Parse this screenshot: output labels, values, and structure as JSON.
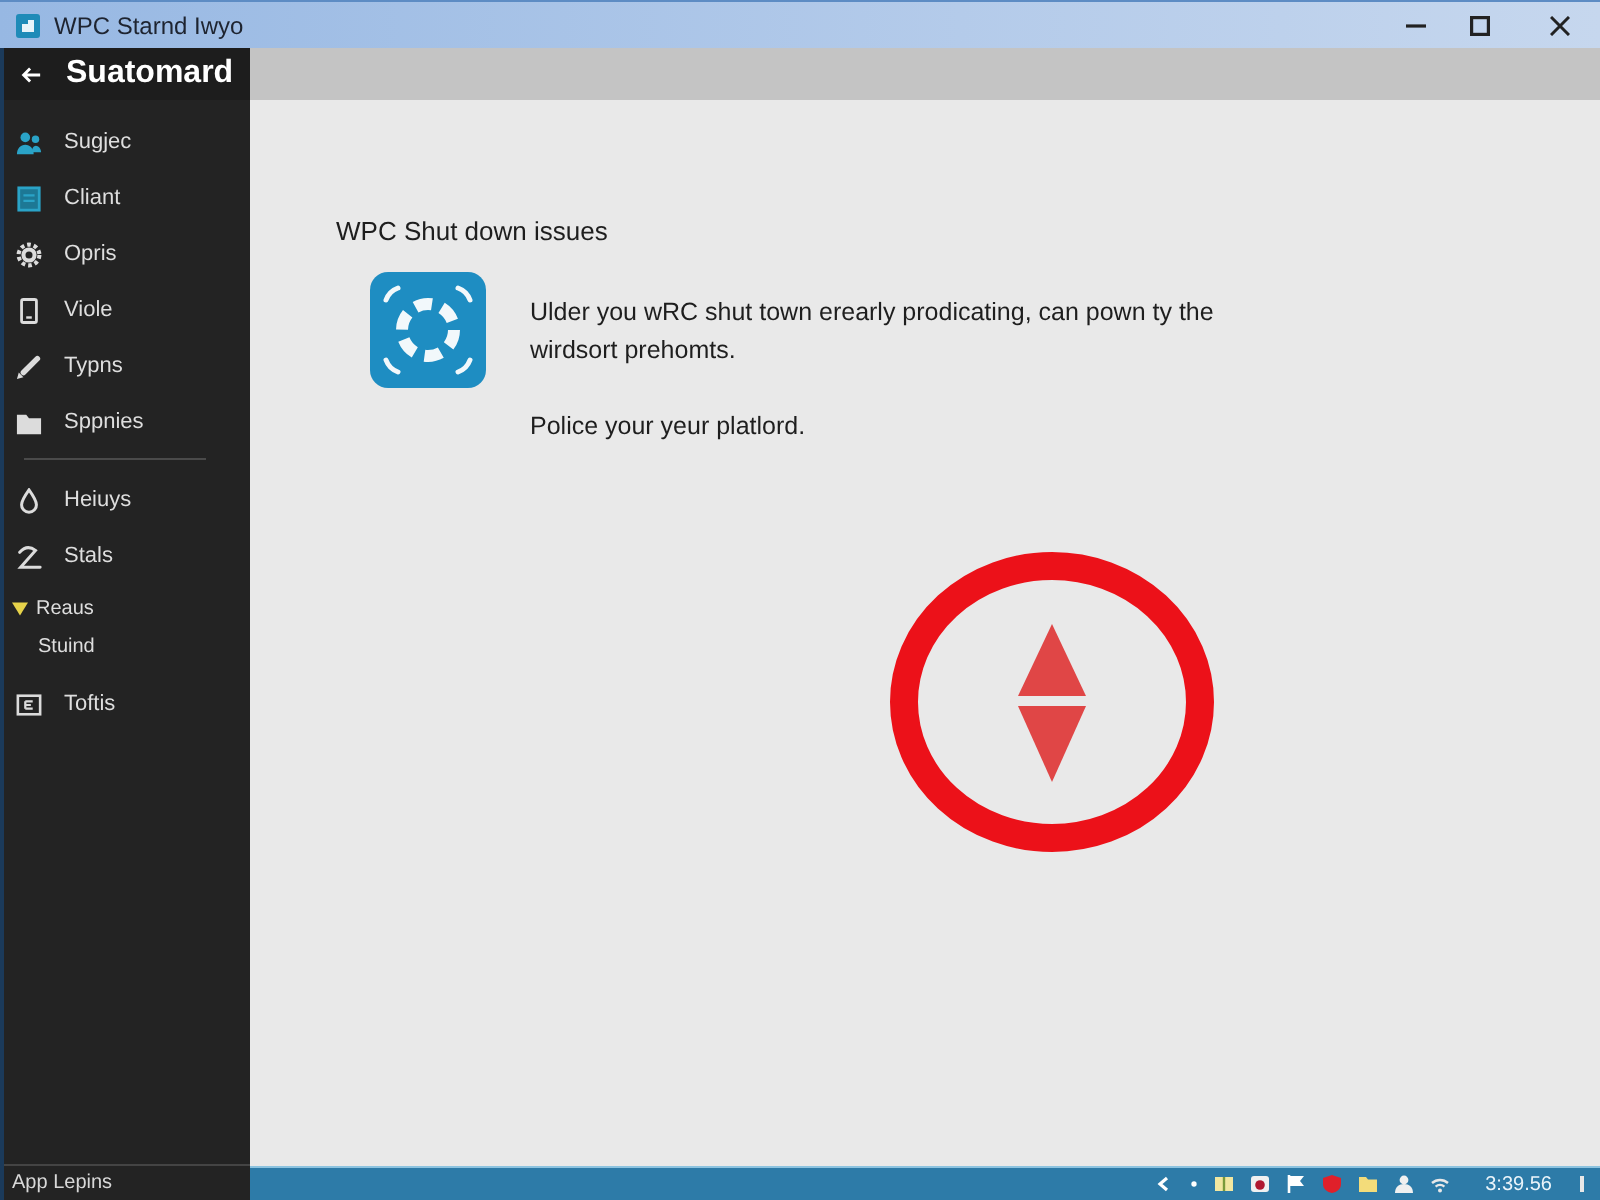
{
  "window": {
    "title": "WPC Starnd Iwyo"
  },
  "sidebar": {
    "header": "Suatomard",
    "sections": [
      {
        "items": [
          {
            "kind": "link",
            "label": "Sugjec"
          },
          {
            "kind": "link",
            "label": "Cliant"
          },
          {
            "kind": "link",
            "label": "Opris"
          },
          {
            "kind": "link",
            "label": "Viole"
          },
          {
            "kind": "link",
            "label": "Typns"
          },
          {
            "kind": "link",
            "label": "Sppnies"
          }
        ]
      },
      {
        "items": [
          {
            "kind": "link",
            "label": "Heiuys"
          },
          {
            "kind": "link",
            "label": "Stals"
          },
          {
            "kind": "group",
            "label": "Reaus",
            "expanded": true,
            "children": [
              {
                "label": "Stuind"
              }
            ]
          },
          {
            "kind": "link",
            "label": "Toftis"
          }
        ]
      }
    ],
    "footer": "App Lepins"
  },
  "content": {
    "heading": "WPC Shut down issues",
    "message": "Ulder you wRC shut town erearly prodicating, can pown ty the wirdsort prehomts.",
    "hint": "Police your yeur platlord."
  },
  "taskbar": {
    "clock": "3:39.56"
  }
}
